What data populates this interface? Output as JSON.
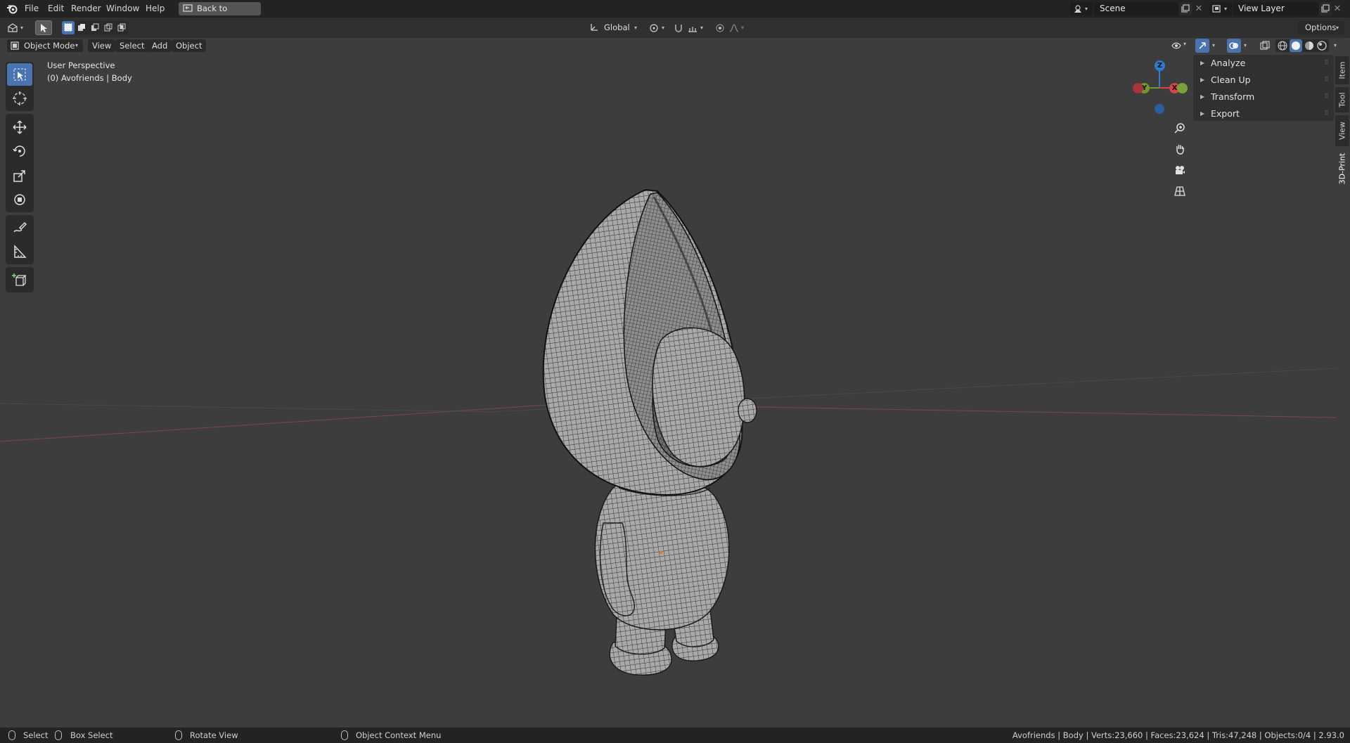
{
  "menubar": {
    "items": [
      "File",
      "Edit",
      "Render",
      "Window",
      "Help"
    ],
    "back_button": "Back to Previous",
    "scene": "Scene",
    "view_layer": "View Layer"
  },
  "header": {
    "transform_orientation": "Global",
    "options_label": "Options"
  },
  "viewport_header": {
    "mode": "Object Mode",
    "menus": [
      "View",
      "Select",
      "Add",
      "Object"
    ]
  },
  "viewport": {
    "perspective_label": "User Perspective",
    "object_label": "(0) Avofriends | Body"
  },
  "gizmo": {
    "x": "X",
    "y": "Y",
    "z": "Z"
  },
  "sidebar": {
    "panels": [
      "Analyze",
      "Clean Up",
      "Transform",
      "Export"
    ],
    "tabs": [
      "Item",
      "Tool",
      "View",
      "3D-Print"
    ],
    "active_tab": "3D-Print"
  },
  "statusbar": {
    "select": "Select",
    "box_select": "Box Select",
    "rotate_view": "Rotate View",
    "context_menu": "Object Context Menu",
    "stats": "Avofriends | Body | Verts:23,660 | Faces:23,624 | Tris:47,248 | Objects:0/4 | 2.93.0"
  },
  "colors": {
    "accent_active": "#4a74b0",
    "axis_x": "#d6444e",
    "axis_y": "#6f9b2c",
    "axis_z": "#2f7bd6"
  }
}
